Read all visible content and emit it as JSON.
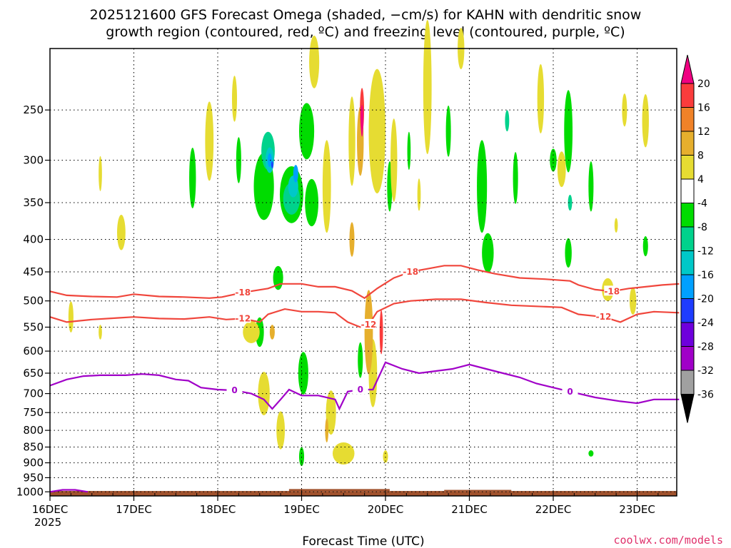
{
  "chart_data": {
    "type": "heatmap",
    "title_lines": [
      "2025121600 GFS Forecast Omega (shaded, −cm/s) for KAHN with dendritic snow",
      "growth region (contoured, red, ºC) and freezing level (contoured, purple, ºC)"
    ],
    "xlabel": "Forecast Time (UTC)",
    "credit": "coolwx.com/models",
    "x_ticks": [
      "16DEC",
      "17DEC",
      "18DEC",
      "19DEC",
      "20DEC",
      "21DEC",
      "22DEC",
      "23DEC"
    ],
    "x_year": "2025",
    "xlim_days": [
      0,
      7.5
    ],
    "y_ticks": [
      250,
      300,
      350,
      400,
      450,
      500,
      550,
      600,
      650,
      700,
      750,
      800,
      850,
      900,
      950,
      1000
    ],
    "ylim_hpa": [
      200,
      1015
    ],
    "y_scale": "log-pressure",
    "grid": true,
    "colorbar": {
      "levels": [
        -36,
        -32,
        -28,
        -24,
        -20,
        -16,
        -12,
        -8,
        -4,
        4,
        8,
        12,
        16,
        20
      ],
      "colors": [
        "#000000",
        "#a0a0a0",
        "#a000c8",
        "#6e00dc",
        "#1e3cff",
        "#00a0ff",
        "#00c8c8",
        "#00d28c",
        "#00dc00",
        "#ffffff",
        "#e6dc32",
        "#e6af2d",
        "#f08228",
        "#fa3c3c",
        "#f00082"
      ]
    },
    "contours": [
      {
        "label": "-18",
        "color": "#f0463c",
        "points": [
          [
            0.0,
            483
          ],
          [
            0.2,
            490
          ],
          [
            0.5,
            492
          ],
          [
            0.8,
            493
          ],
          [
            1.0,
            488
          ],
          [
            1.3,
            492
          ],
          [
            1.6,
            493
          ],
          [
            1.9,
            495
          ],
          [
            2.05,
            493
          ],
          [
            2.3,
            485
          ],
          [
            2.6,
            478
          ],
          [
            2.75,
            470
          ],
          [
            3.0,
            470
          ],
          [
            3.2,
            475
          ],
          [
            3.4,
            475
          ],
          [
            3.6,
            482
          ],
          [
            3.75,
            495
          ],
          [
            3.9,
            478
          ],
          [
            4.1,
            460
          ],
          [
            4.3,
            450
          ],
          [
            4.5,
            445
          ],
          [
            4.7,
            440
          ],
          [
            4.9,
            440
          ],
          [
            5.1,
            447
          ],
          [
            5.3,
            453
          ],
          [
            5.6,
            460
          ],
          [
            5.9,
            462
          ],
          [
            6.2,
            465
          ],
          [
            6.3,
            472
          ],
          [
            6.5,
            480
          ],
          [
            6.7,
            483
          ],
          [
            6.9,
            478
          ],
          [
            7.1,
            475
          ],
          [
            7.3,
            472
          ],
          [
            7.5,
            470
          ]
        ]
      },
      {
        "label": "-12",
        "color": "#f0463c",
        "points": [
          [
            0.0,
            530
          ],
          [
            0.2,
            540
          ],
          [
            0.5,
            535
          ],
          [
            0.8,
            532
          ],
          [
            1.0,
            530
          ],
          [
            1.3,
            533
          ],
          [
            1.6,
            534
          ],
          [
            1.9,
            530
          ],
          [
            2.1,
            535
          ],
          [
            2.3,
            533
          ],
          [
            2.5,
            540
          ],
          [
            2.6,
            525
          ],
          [
            2.8,
            515
          ],
          [
            3.0,
            520
          ],
          [
            3.2,
            520
          ],
          [
            3.4,
            522
          ],
          [
            3.55,
            540
          ],
          [
            3.7,
            550
          ],
          [
            3.8,
            545
          ],
          [
            3.9,
            520
          ],
          [
            4.1,
            505
          ],
          [
            4.3,
            500
          ],
          [
            4.6,
            497
          ],
          [
            4.9,
            497
          ],
          [
            5.2,
            503
          ],
          [
            5.5,
            508
          ],
          [
            5.8,
            510
          ],
          [
            6.1,
            512
          ],
          [
            6.3,
            525
          ],
          [
            6.6,
            530
          ],
          [
            6.8,
            540
          ],
          [
            7.0,
            525
          ],
          [
            7.2,
            520
          ],
          [
            7.5,
            522
          ]
        ]
      },
      {
        "label": "0",
        "color": "#a000c8",
        "points": [
          [
            0.0,
            680
          ],
          [
            0.2,
            665
          ],
          [
            0.4,
            657
          ],
          [
            0.6,
            655
          ],
          [
            0.9,
            655
          ],
          [
            1.1,
            652
          ],
          [
            1.3,
            655
          ],
          [
            1.5,
            665
          ],
          [
            1.65,
            668
          ],
          [
            1.8,
            685
          ],
          [
            2.0,
            690
          ],
          [
            2.2,
            692
          ],
          [
            2.4,
            700
          ],
          [
            2.55,
            715
          ],
          [
            2.65,
            740
          ],
          [
            2.75,
            715
          ],
          [
            2.85,
            690
          ],
          [
            3.0,
            705
          ],
          [
            3.2,
            705
          ],
          [
            3.4,
            715
          ],
          [
            3.45,
            740
          ],
          [
            3.55,
            695
          ],
          [
            3.7,
            690
          ],
          [
            3.85,
            690
          ],
          [
            4.0,
            625
          ],
          [
            4.2,
            640
          ],
          [
            4.4,
            650
          ],
          [
            4.6,
            645
          ],
          [
            4.8,
            640
          ],
          [
            5.0,
            630
          ],
          [
            5.2,
            640
          ],
          [
            5.4,
            650
          ],
          [
            5.6,
            660
          ],
          [
            5.8,
            675
          ],
          [
            6.0,
            685
          ],
          [
            6.2,
            695
          ],
          [
            6.5,
            710
          ],
          [
            6.8,
            720
          ],
          [
            7.0,
            725
          ],
          [
            7.2,
            715
          ],
          [
            7.5,
            715
          ]
        ]
      },
      {
        "label": "",
        "color": "#a000c8",
        "points": [
          [
            0.0,
            1000
          ],
          [
            0.15,
            993
          ],
          [
            0.3,
            993
          ],
          [
            0.45,
            1000
          ]
        ]
      }
    ]
  }
}
